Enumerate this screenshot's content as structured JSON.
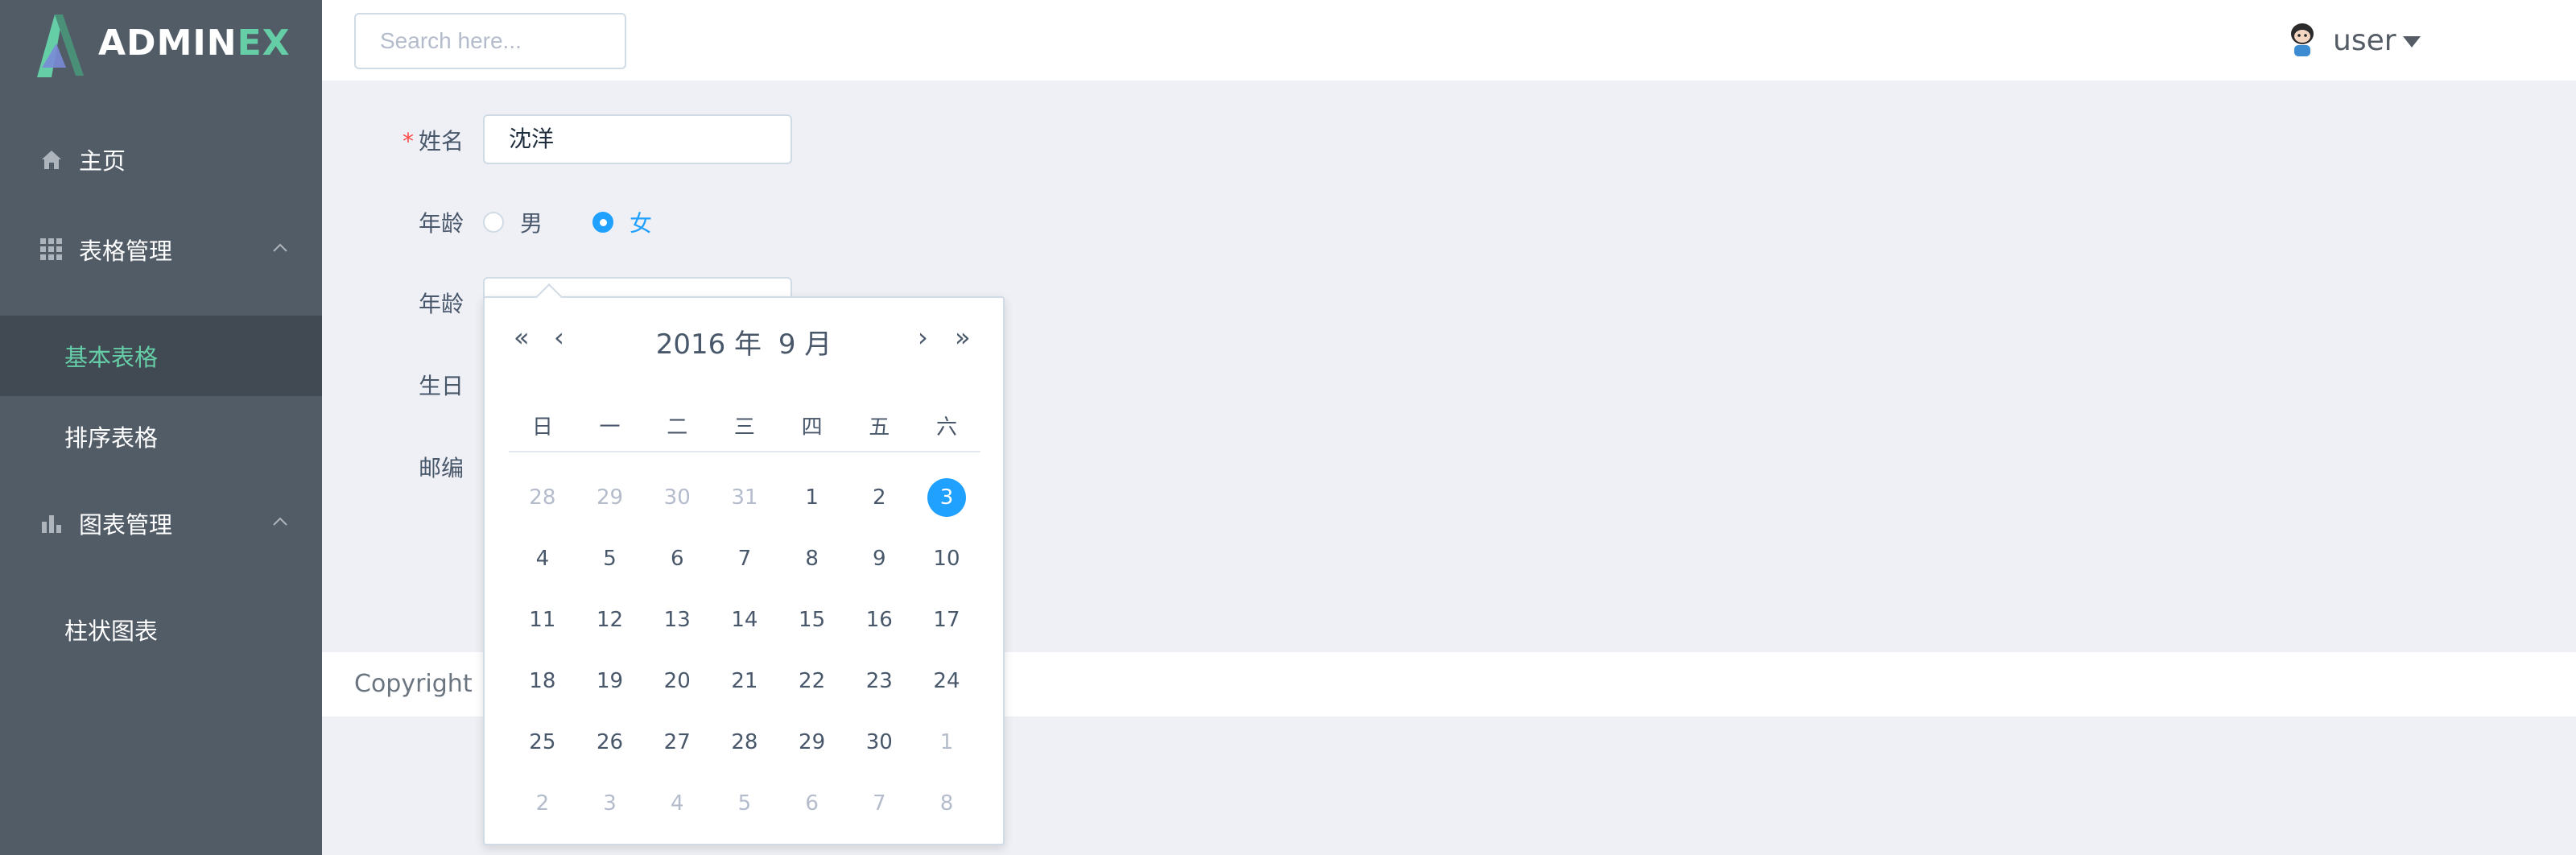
{
  "brand": {
    "logo_main": "ADMIN",
    "logo_accent": "EX",
    "colors": {
      "accent": "#65cea7",
      "primary": "#20a0ff",
      "sidebar": "#525c67"
    }
  },
  "sidebar": {
    "items": [
      {
        "label": "主页",
        "icon": "home-icon"
      },
      {
        "label": "表格管理",
        "icon": "grid-icon"
      },
      {
        "label": "图表管理",
        "icon": "bar-chart-icon"
      }
    ],
    "sub_items": [
      {
        "label": "基本表格",
        "active": true
      },
      {
        "label": "排序表格"
      },
      {
        "label": "柱状图表"
      }
    ]
  },
  "header": {
    "search_placeholder": "Search here...",
    "user_name": "user"
  },
  "form": {
    "name_label": "姓名",
    "name_value": "沈洋",
    "gender_label": "年龄",
    "gender_options": [
      "男",
      "女"
    ],
    "gender_selected": "女",
    "age_label": "年龄",
    "birthday_label": "生日",
    "zip_label": "邮编"
  },
  "datepicker": {
    "title_year": "2016 年",
    "title_month": "9 月",
    "weekdays": [
      "日",
      "一",
      "二",
      "三",
      "四",
      "五",
      "六"
    ],
    "weeks": [
      [
        {
          "d": "28",
          "m": true
        },
        {
          "d": "29",
          "m": true
        },
        {
          "d": "30",
          "m": true
        },
        {
          "d": "31",
          "m": true
        },
        {
          "d": "1"
        },
        {
          "d": "2"
        },
        {
          "d": "3",
          "sel": true
        }
      ],
      [
        {
          "d": "4"
        },
        {
          "d": "5"
        },
        {
          "d": "6"
        },
        {
          "d": "7"
        },
        {
          "d": "8"
        },
        {
          "d": "9"
        },
        {
          "d": "10"
        }
      ],
      [
        {
          "d": "11"
        },
        {
          "d": "12"
        },
        {
          "d": "13"
        },
        {
          "d": "14"
        },
        {
          "d": "15"
        },
        {
          "d": "16"
        },
        {
          "d": "17"
        }
      ],
      [
        {
          "d": "18"
        },
        {
          "d": "19"
        },
        {
          "d": "20"
        },
        {
          "d": "21"
        },
        {
          "d": "22"
        },
        {
          "d": "23"
        },
        {
          "d": "24"
        }
      ],
      [
        {
          "d": "25"
        },
        {
          "d": "26"
        },
        {
          "d": "27"
        },
        {
          "d": "28"
        },
        {
          "d": "29"
        },
        {
          "d": "30"
        },
        {
          "d": "1",
          "m": true
        }
      ],
      [
        {
          "d": "2",
          "m": true
        },
        {
          "d": "3",
          "m": true
        },
        {
          "d": "4",
          "m": true
        },
        {
          "d": "5",
          "m": true
        },
        {
          "d": "6",
          "m": true
        },
        {
          "d": "7",
          "m": true
        },
        {
          "d": "8",
          "m": true
        }
      ]
    ]
  },
  "footer": {
    "text": "Copyright ©"
  }
}
